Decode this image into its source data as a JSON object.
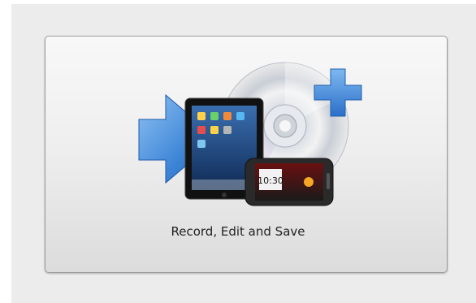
{
  "tile": {
    "label": "Record, Edit and Save"
  },
  "icons": {
    "disc": "cd-disc-icon",
    "plus": "plus-icon",
    "arrow": "arrow-right-icon",
    "tablet": "tablet-icon",
    "phone": "phone-icon"
  },
  "phone_clock": "10:30",
  "colors": {
    "accent_blue": "#3a7fd6",
    "panel_bg": "#ececec"
  }
}
